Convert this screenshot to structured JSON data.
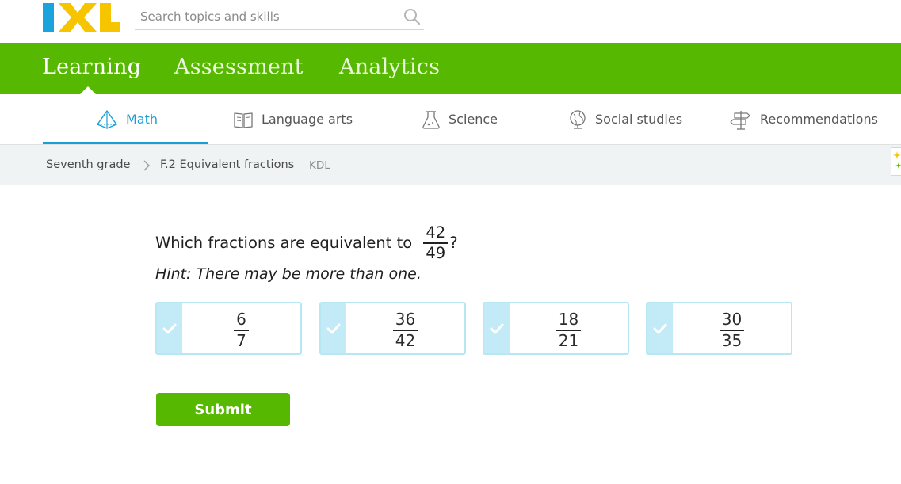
{
  "header": {
    "logo_text": "IXL",
    "search_placeholder": "Search topics and skills"
  },
  "main_nav": {
    "tabs": [
      {
        "label": "Learning",
        "active": true
      },
      {
        "label": "Assessment",
        "active": false
      },
      {
        "label": "Analytics",
        "active": false
      }
    ]
  },
  "subject_nav": {
    "items": [
      {
        "label": "Math",
        "icon": "pyramid-icon",
        "active": true
      },
      {
        "label": "Language arts",
        "icon": "book-icon",
        "active": false
      },
      {
        "label": "Science",
        "icon": "flask-icon",
        "active": false
      },
      {
        "label": "Social studies",
        "icon": "globe-icon",
        "active": false
      },
      {
        "label": "Recommendations",
        "icon": "signpost-icon",
        "active": false
      }
    ]
  },
  "breadcrumb": {
    "grade": "Seventh grade",
    "skill": "F.2 Equivalent fractions",
    "code": "KDL"
  },
  "question": {
    "prompt": "Which fractions are equivalent to",
    "fraction": {
      "numerator": "42",
      "denominator": "49"
    },
    "suffix": "?",
    "hint": "Hint: There may be more than one."
  },
  "choices": [
    {
      "numerator": "6",
      "denominator": "7"
    },
    {
      "numerator": "36",
      "denominator": "42"
    },
    {
      "numerator": "18",
      "denominator": "21"
    },
    {
      "numerator": "30",
      "denominator": "35"
    }
  ],
  "submit_label": "Submit",
  "colors": {
    "brand_green": "#56b800",
    "accent_blue": "#1a9ed6",
    "choice_border": "#b8e6f2",
    "choice_check_bg": "#c3ebf7"
  }
}
